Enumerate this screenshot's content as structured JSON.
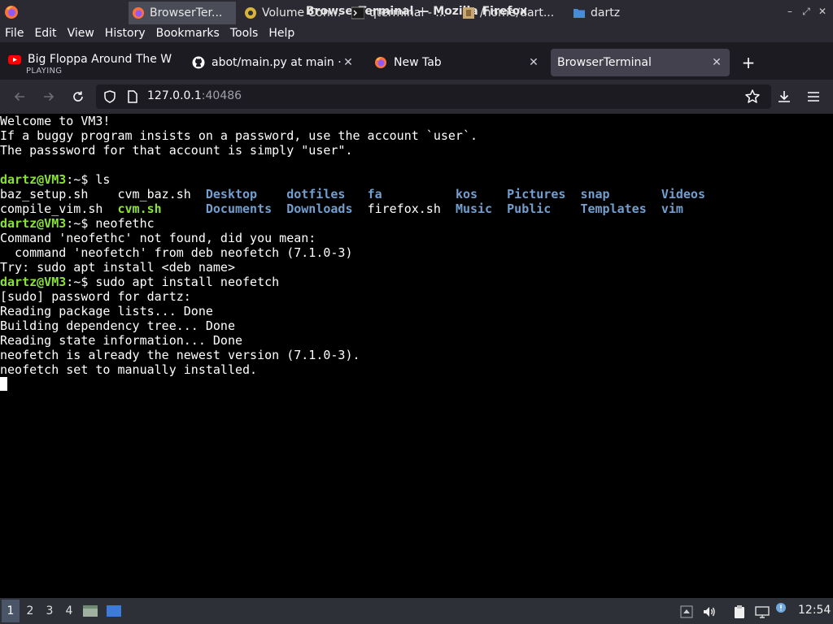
{
  "window": {
    "title": "BrowserTerminal — Mozilla Firefox",
    "controls": [
      "–",
      "⤢",
      "✕"
    ]
  },
  "menubar": {
    "items": [
      "File",
      "Edit",
      "View",
      "History",
      "Bookmarks",
      "Tools",
      "Help"
    ]
  },
  "tabs": [
    {
      "label": "Big Floppa Around The W",
      "sublabel": "PLAYING",
      "icon": "youtube-icon",
      "active": false
    },
    {
      "label": "abot/main.py at main · Tr",
      "icon": "github-icon",
      "active": false
    },
    {
      "label": "New Tab",
      "icon": "firefox-icon",
      "active": false
    },
    {
      "label": "BrowserTerminal",
      "icon": "none",
      "active": true
    }
  ],
  "newtab_label": "+",
  "urlbar": {
    "host": "127.0.0.1",
    "port": ":40486"
  },
  "terminal": {
    "motd": [
      "Welcome to VM3!",
      "If a buggy program insists on a password, use the account `user`.",
      "The passsword for that account is simply \"user\"."
    ],
    "prompt_user": "dartz@VM3",
    "prompt_suffix": ":~$ ",
    "cmd_ls": "ls",
    "ls_row1": [
      {
        "text": "baz_setup.sh    ",
        "kind": "file"
      },
      {
        "text": "cvm_baz.sh  ",
        "kind": "file"
      },
      {
        "text": "Desktop    ",
        "kind": "dir"
      },
      {
        "text": "dotfiles   ",
        "kind": "dir"
      },
      {
        "text": "fa          ",
        "kind": "dir"
      },
      {
        "text": "kos    ",
        "kind": "dir"
      },
      {
        "text": "Pictures  ",
        "kind": "dir"
      },
      {
        "text": "snap       ",
        "kind": "dir"
      },
      {
        "text": "Videos",
        "kind": "dir"
      }
    ],
    "ls_row2": [
      {
        "text": "compile_vim.sh  ",
        "kind": "file"
      },
      {
        "text": "cvm.sh      ",
        "kind": "exe"
      },
      {
        "text": "Documents  ",
        "kind": "dir"
      },
      {
        "text": "Downloads  ",
        "kind": "dir"
      },
      {
        "text": "firefox.sh  ",
        "kind": "file"
      },
      {
        "text": "Music  ",
        "kind": "dir"
      },
      {
        "text": "Public    ",
        "kind": "dir"
      },
      {
        "text": "Templates  ",
        "kind": "dir"
      },
      {
        "text": "vim",
        "kind": "dir"
      }
    ],
    "cmd_neofethc": "neofethc",
    "not_found": [
      "Command 'neofethc' not found, did you mean:",
      "  command 'neofetch' from deb neofetch (7.1.0-3)",
      "Try: sudo apt install <deb name>"
    ],
    "cmd_install": "sudo apt install neofetch",
    "install_out": [
      "[sudo] password for dartz:",
      "Reading package lists... Done",
      "Building dependency tree... Done",
      "Reading state information... Done",
      "neofetch is already the newest version (7.1.0-3).",
      "neofetch set to manually installed."
    ]
  },
  "taskbar": {
    "workspaces": [
      "1",
      "2",
      "3",
      "4"
    ],
    "tasks": [
      {
        "label": "BrowserTer...",
        "icon": "firefox-icon",
        "active": true
      },
      {
        "label": "Volume Con...",
        "icon": "volume-control-icon",
        "active": false
      },
      {
        "label": "qterminal - ...",
        "icon": "terminal-icon",
        "active": false
      },
      {
        "label": "/home/dart...",
        "icon": "file-manager-icon",
        "active": false
      },
      {
        "label": "dartz",
        "icon": "folder-icon",
        "active": false
      }
    ],
    "clock": "12:54"
  },
  "colors": {
    "terminal_bg": "#000000",
    "prompt_green": "#8ae234",
    "dir_blue": "#729fcf",
    "chrome_dark": "#2b2a33",
    "active_tab": "#42414d"
  }
}
